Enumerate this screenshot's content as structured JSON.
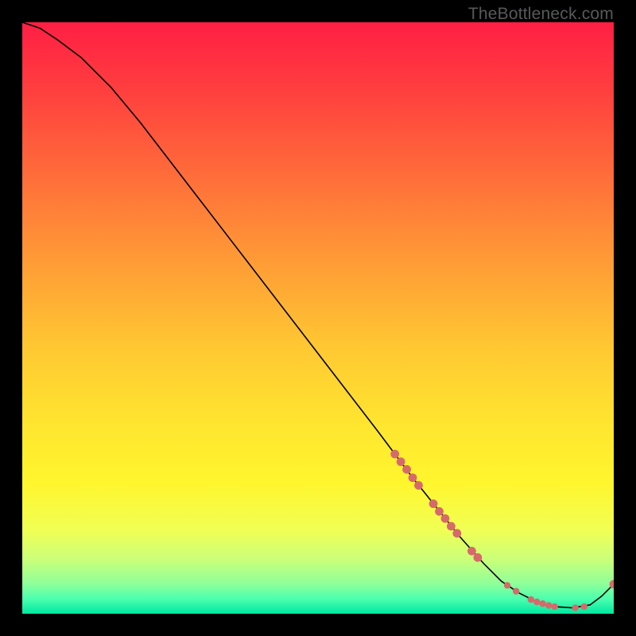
{
  "watermark": "TheBottleneck.com",
  "chart_data": {
    "type": "line",
    "title": "",
    "xlabel": "",
    "ylabel": "",
    "xlim": [
      0,
      100
    ],
    "ylim": [
      0,
      100
    ],
    "grid": false,
    "legend": false,
    "background_gradient": {
      "stops": [
        {
          "offset": 0.0,
          "color": "#ff1f44"
        },
        {
          "offset": 0.1,
          "color": "#ff3a3f"
        },
        {
          "offset": 0.25,
          "color": "#ff6a3a"
        },
        {
          "offset": 0.4,
          "color": "#ff9a36"
        },
        {
          "offset": 0.55,
          "color": "#ffc832"
        },
        {
          "offset": 0.68,
          "color": "#ffe52f"
        },
        {
          "offset": 0.78,
          "color": "#fff62e"
        },
        {
          "offset": 0.86,
          "color": "#f0ff55"
        },
        {
          "offset": 0.91,
          "color": "#c8ff7a"
        },
        {
          "offset": 0.95,
          "color": "#8dff9a"
        },
        {
          "offset": 0.975,
          "color": "#4affae"
        },
        {
          "offset": 1.0,
          "color": "#00e8a0"
        }
      ]
    },
    "series": [
      {
        "name": "bottleneck-curve",
        "color": "#000000",
        "x": [
          0,
          3,
          6,
          10,
          15,
          20,
          25,
          30,
          35,
          40,
          45,
          50,
          55,
          60,
          63,
          66,
          70,
          74,
          78,
          81,
          84,
          87,
          90,
          93,
          96,
          98,
          100
        ],
        "y": [
          100,
          99,
          97,
          94,
          89,
          83,
          76.5,
          70,
          63.5,
          57,
          50.5,
          44,
          37.5,
          31,
          27,
          23,
          18,
          13,
          8.5,
          5.5,
          3.5,
          2,
          1.2,
          1,
          1.5,
          3,
          5
        ]
      }
    ],
    "markers": {
      "name": "highlighted-points",
      "color": "#d66a6a",
      "radius_small": 4.2,
      "radius_large": 5.4,
      "points": [
        {
          "x": 63.0,
          "y": 27.0,
          "r": "l"
        },
        {
          "x": 64.0,
          "y": 25.7,
          "r": "l"
        },
        {
          "x": 65.0,
          "y": 24.4,
          "r": "l"
        },
        {
          "x": 66.0,
          "y": 23.0,
          "r": "l"
        },
        {
          "x": 67.0,
          "y": 21.7,
          "r": "l"
        },
        {
          "x": 69.5,
          "y": 18.6,
          "r": "l"
        },
        {
          "x": 70.5,
          "y": 17.3,
          "r": "l"
        },
        {
          "x": 71.5,
          "y": 16.1,
          "r": "l"
        },
        {
          "x": 72.5,
          "y": 14.8,
          "r": "l"
        },
        {
          "x": 73.5,
          "y": 13.6,
          "r": "l"
        },
        {
          "x": 76.0,
          "y": 10.6,
          "r": "l"
        },
        {
          "x": 77.0,
          "y": 9.5,
          "r": "l"
        },
        {
          "x": 82.0,
          "y": 4.8,
          "r": "s"
        },
        {
          "x": 83.5,
          "y": 3.8,
          "r": "s"
        },
        {
          "x": 86.0,
          "y": 2.4,
          "r": "s"
        },
        {
          "x": 87.0,
          "y": 2.0,
          "r": "s"
        },
        {
          "x": 88.0,
          "y": 1.7,
          "r": "s"
        },
        {
          "x": 89.0,
          "y": 1.4,
          "r": "s"
        },
        {
          "x": 90.0,
          "y": 1.2,
          "r": "s"
        },
        {
          "x": 93.5,
          "y": 1.0,
          "r": "s"
        },
        {
          "x": 95.0,
          "y": 1.2,
          "r": "s"
        },
        {
          "x": 100.0,
          "y": 5.0,
          "r": "l"
        }
      ]
    }
  }
}
